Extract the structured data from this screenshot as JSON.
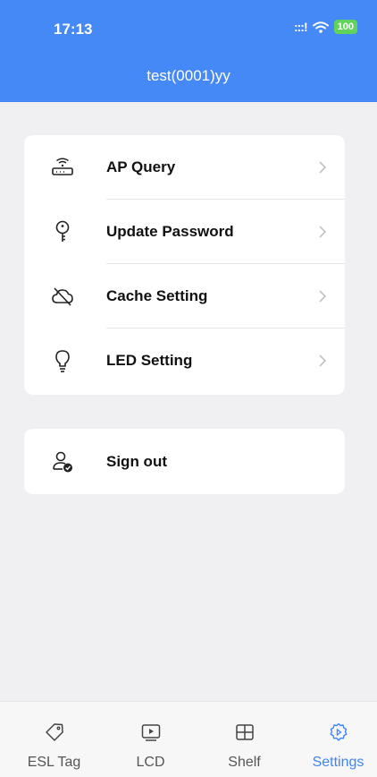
{
  "status_bar": {
    "time": "17:13",
    "signal": ":::!",
    "battery": "100",
    "icons": [
      "signal-icon",
      "wifi-icon",
      "battery-icon"
    ]
  },
  "header": {
    "title": "test(0001)yy",
    "background_color": "#4489f5"
  },
  "settings_list": {
    "items": [
      {
        "label": "AP Query",
        "icon": "router-icon"
      },
      {
        "label": "Update Password",
        "icon": "key-icon"
      },
      {
        "label": "Cache Setting",
        "icon": "cloud-off-icon"
      },
      {
        "label": "LED Setting",
        "icon": "lightbulb-icon"
      }
    ]
  },
  "sign_out": {
    "label": "Sign out",
    "icon": "user-check-icon"
  },
  "tabbar": {
    "tabs": [
      {
        "label": "ESL Tag",
        "icon": "tag-icon",
        "active": false
      },
      {
        "label": "LCD",
        "icon": "play-screen-icon",
        "active": false
      },
      {
        "label": "Shelf",
        "icon": "shelf-grid-icon",
        "active": false
      },
      {
        "label": "Settings",
        "icon": "gear-icon",
        "active": true
      }
    ],
    "active_color": "#3f86f4"
  }
}
